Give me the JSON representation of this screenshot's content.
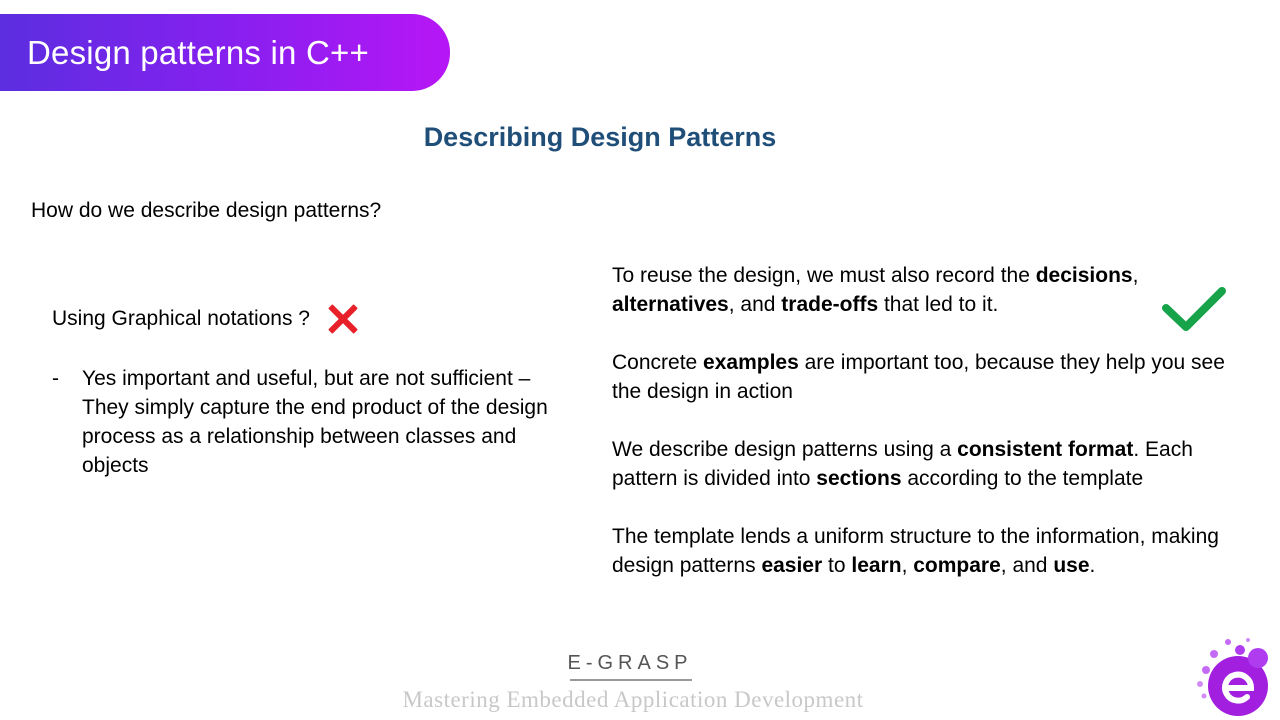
{
  "slide": {
    "title": "Design patterns in C++",
    "heading": "Describing Design Patterns",
    "question": "How do we describe design patterns?"
  },
  "left": {
    "subheading": "Using Graphical notations ?",
    "bullet_marker": "-",
    "bullet_text": "Yes important and useful, but are not sufficient – They simply capture the end product of the design process as a relationship between classes and objects"
  },
  "right": {
    "p1": {
      "a": "To reuse the design, we must also record the ",
      "b1": "decisions",
      "c": ", ",
      "b2": "alternatives",
      "d": ", and ",
      "b3": "trade-offs",
      "e": " that led to it."
    },
    "p2": {
      "a": "Concrete ",
      "b1": "examples",
      "c": " are important too, because they help you see the design in action"
    },
    "p3": {
      "a": "We describe design patterns using a ",
      "b1": "consistent format",
      "c": ". Each pattern is divided into ",
      "b2": "sections",
      "d": " according to the template"
    },
    "p4": {
      "a": "The template lends a uniform structure to the information, making design patterns ",
      "b1": "easier",
      "c": " to ",
      "b2": "learn",
      "d": ", ",
      "b3": "compare",
      "e": ", and ",
      "b4": "use",
      "f": "."
    }
  },
  "footer": {
    "brand": "E-GRASP",
    "tagline": "Mastering Embedded Application Development"
  },
  "icons": {
    "cross": "cross-icon",
    "check": "checkmark-icon",
    "logo": "egrasp-logo"
  },
  "colors": {
    "banner_start": "#5b2ee0",
    "banner_end": "#b716f5",
    "heading": "#1f4e79",
    "cross": "#e8202a",
    "check": "#16a34a",
    "logo": "#a21fe0"
  }
}
